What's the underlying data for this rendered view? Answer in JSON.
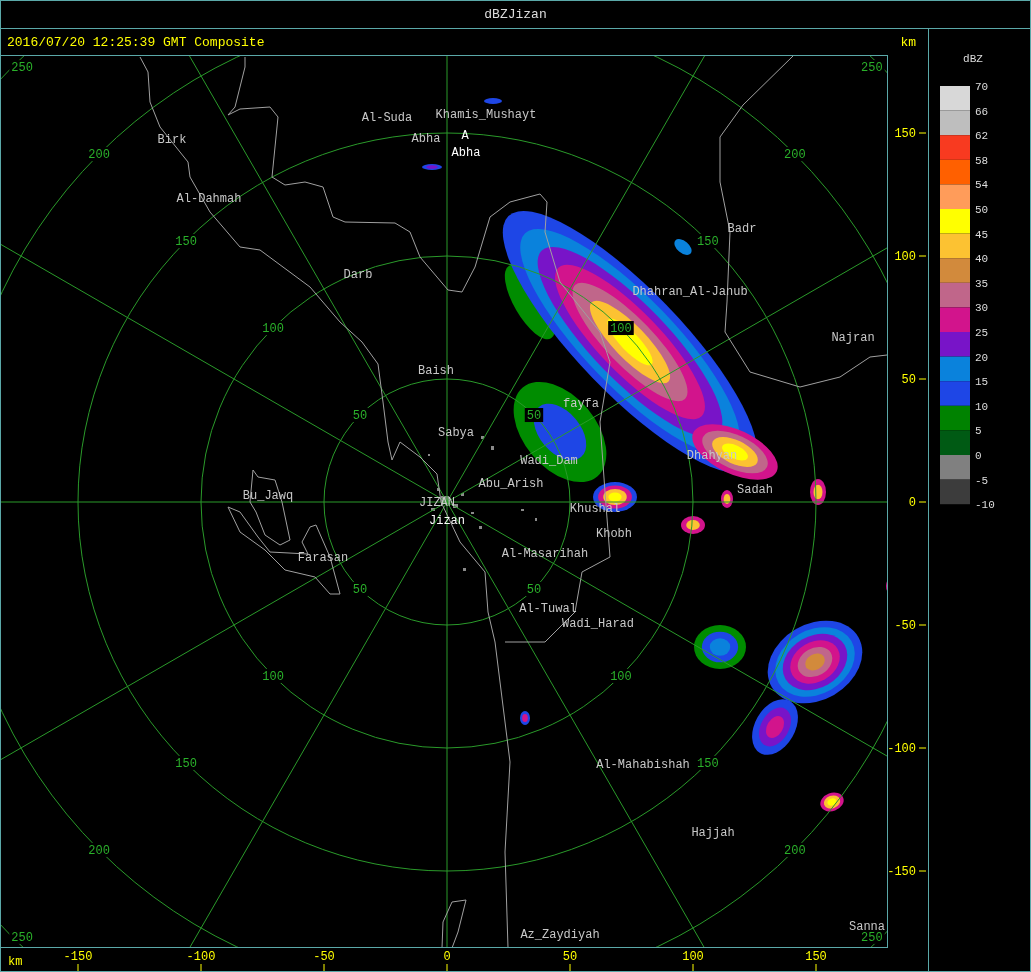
{
  "window": {
    "title": "dBZJizan"
  },
  "header": {
    "timestamp": "2016/07/20 12:25:39 GMT Composite",
    "unit": "km"
  },
  "map": {
    "places": [
      {
        "label": "Al-Suda",
        "kind": "town"
      },
      {
        "label": "Khamis_Mushayt",
        "kind": "town"
      },
      {
        "label": "Birk",
        "kind": "town"
      },
      {
        "label": "Abha",
        "kind": "town"
      },
      {
        "label": "A",
        "kind": "site"
      },
      {
        "label": "Abha",
        "kind": "site"
      },
      {
        "label": "Al-Dahmah",
        "kind": "town"
      },
      {
        "label": "Badr",
        "kind": "town"
      },
      {
        "label": "Darb",
        "kind": "town"
      },
      {
        "label": "Dhahran_Al-Janub",
        "kind": "town"
      },
      {
        "label": "Najran",
        "kind": "town"
      },
      {
        "label": "Baish",
        "kind": "town"
      },
      {
        "label": "fayfa",
        "kind": "town"
      },
      {
        "label": "Sabya",
        "kind": "town"
      },
      {
        "label": "Wadi_Dam",
        "kind": "town"
      },
      {
        "label": "Dhahyan",
        "kind": "town"
      },
      {
        "label": "Abu_Arish",
        "kind": "town"
      },
      {
        "label": "Sadah",
        "kind": "town"
      },
      {
        "label": "Bu_Jawq",
        "kind": "town"
      },
      {
        "label": "JIZAN",
        "kind": "town"
      },
      {
        "label": "Jizan",
        "kind": "site"
      },
      {
        "label": "Khushal",
        "kind": "town"
      },
      {
        "label": "Khobh",
        "kind": "town"
      },
      {
        "label": "Al-Masarihah",
        "kind": "town"
      },
      {
        "label": "Farasan",
        "kind": "town"
      },
      {
        "label": "Al-Tuwal",
        "kind": "town"
      },
      {
        "label": "Wadi_Harad",
        "kind": "town"
      },
      {
        "label": "Al-Mahabishah",
        "kind": "town"
      },
      {
        "label": "Hajjah",
        "kind": "town"
      },
      {
        "label": "Az_Zaydiyah",
        "kind": "town"
      },
      {
        "label": "Sanna",
        "kind": "town"
      }
    ],
    "ring_labels": [
      [
        "250",
        "200",
        "150",
        "100",
        "50"
      ],
      [
        "250",
        "200",
        "150",
        "100",
        "50"
      ],
      [
        "250",
        "200",
        "150",
        "100",
        "50"
      ],
      [
        "250",
        "200",
        "150",
        "100",
        "50"
      ]
    ]
  },
  "y_axis": {
    "ticks": [
      "150",
      "100",
      "50",
      "0",
      "-50",
      "-100",
      "-150"
    ]
  },
  "x_axis": {
    "unit": "km",
    "ticks": [
      "-150",
      "-100",
      "-50",
      "0",
      "50",
      "100",
      "150"
    ]
  },
  "legend": {
    "title": "dBZ",
    "bins": [
      {
        "label": "70",
        "color": "#d8d8d8"
      },
      {
        "label": "66",
        "color": "#bebebe"
      },
      {
        "label": "62",
        "color": "#f83a20"
      },
      {
        "label": "58",
        "color": "#ff6000"
      },
      {
        "label": "54",
        "color": "#ff9c5a"
      },
      {
        "label": "50",
        "color": "#ffff00"
      },
      {
        "label": "45",
        "color": "#fcc232"
      },
      {
        "label": "40",
        "color": "#d28a3c"
      },
      {
        "label": "35",
        "color": "#c0668a"
      },
      {
        "label": "30",
        "color": "#d2148c"
      },
      {
        "label": "25",
        "color": "#7814c8"
      },
      {
        "label": "20",
        "color": "#0a82dc"
      },
      {
        "label": "15",
        "color": "#1e46e6"
      },
      {
        "label": "10",
        "color": "#008200"
      },
      {
        "label": "5",
        "color": "#005a14"
      },
      {
        "label": "0",
        "color": "#808080"
      },
      {
        "label": "-5",
        "color": "#3c3c3c"
      }
    ],
    "bottom_label": "-10"
  }
}
